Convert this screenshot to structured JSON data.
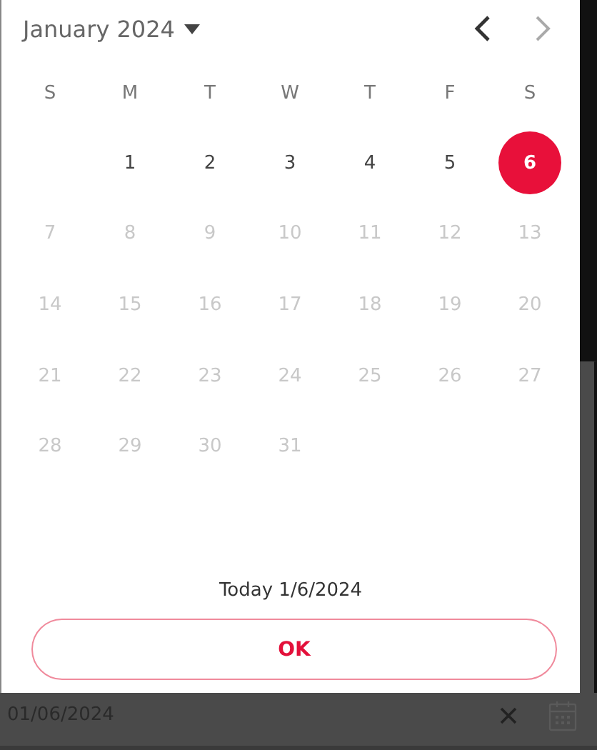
{
  "calendar": {
    "month_label": "January 2024",
    "prev_disabled": false,
    "next_disabled": true,
    "weekdays": [
      "S",
      "M",
      "T",
      "W",
      "T",
      "F",
      "S"
    ],
    "days": [
      {
        "kind": "blank"
      },
      {
        "kind": "day",
        "label": "1",
        "disabled": false,
        "selected": false
      },
      {
        "kind": "day",
        "label": "2",
        "disabled": false,
        "selected": false
      },
      {
        "kind": "day",
        "label": "3",
        "disabled": false,
        "selected": false
      },
      {
        "kind": "day",
        "label": "4",
        "disabled": false,
        "selected": false
      },
      {
        "kind": "day",
        "label": "5",
        "disabled": false,
        "selected": false
      },
      {
        "kind": "day",
        "label": "6",
        "disabled": false,
        "selected": true
      },
      {
        "kind": "day",
        "label": "7",
        "disabled": true,
        "selected": false
      },
      {
        "kind": "day",
        "label": "8",
        "disabled": true,
        "selected": false
      },
      {
        "kind": "day",
        "label": "9",
        "disabled": true,
        "selected": false
      },
      {
        "kind": "day",
        "label": "10",
        "disabled": true,
        "selected": false
      },
      {
        "kind": "day",
        "label": "11",
        "disabled": true,
        "selected": false
      },
      {
        "kind": "day",
        "label": "12",
        "disabled": true,
        "selected": false
      },
      {
        "kind": "day",
        "label": "13",
        "disabled": true,
        "selected": false
      },
      {
        "kind": "day",
        "label": "14",
        "disabled": true,
        "selected": false
      },
      {
        "kind": "day",
        "label": "15",
        "disabled": true,
        "selected": false
      },
      {
        "kind": "day",
        "label": "16",
        "disabled": true,
        "selected": false
      },
      {
        "kind": "day",
        "label": "17",
        "disabled": true,
        "selected": false
      },
      {
        "kind": "day",
        "label": "18",
        "disabled": true,
        "selected": false
      },
      {
        "kind": "day",
        "label": "19",
        "disabled": true,
        "selected": false
      },
      {
        "kind": "day",
        "label": "20",
        "disabled": true,
        "selected": false
      },
      {
        "kind": "day",
        "label": "21",
        "disabled": true,
        "selected": false
      },
      {
        "kind": "day",
        "label": "22",
        "disabled": true,
        "selected": false
      },
      {
        "kind": "day",
        "label": "23",
        "disabled": true,
        "selected": false
      },
      {
        "kind": "day",
        "label": "24",
        "disabled": true,
        "selected": false
      },
      {
        "kind": "day",
        "label": "25",
        "disabled": true,
        "selected": false
      },
      {
        "kind": "day",
        "label": "26",
        "disabled": true,
        "selected": false
      },
      {
        "kind": "day",
        "label": "27",
        "disabled": true,
        "selected": false
      },
      {
        "kind": "day",
        "label": "28",
        "disabled": true,
        "selected": false
      },
      {
        "kind": "day",
        "label": "29",
        "disabled": true,
        "selected": false
      },
      {
        "kind": "day",
        "label": "30",
        "disabled": true,
        "selected": false
      },
      {
        "kind": "day",
        "label": "31",
        "disabled": true,
        "selected": false
      }
    ],
    "today_label": "Today 1/6/2024",
    "ok_button": "OK"
  },
  "date_field": {
    "value": "01/06/2024"
  }
}
